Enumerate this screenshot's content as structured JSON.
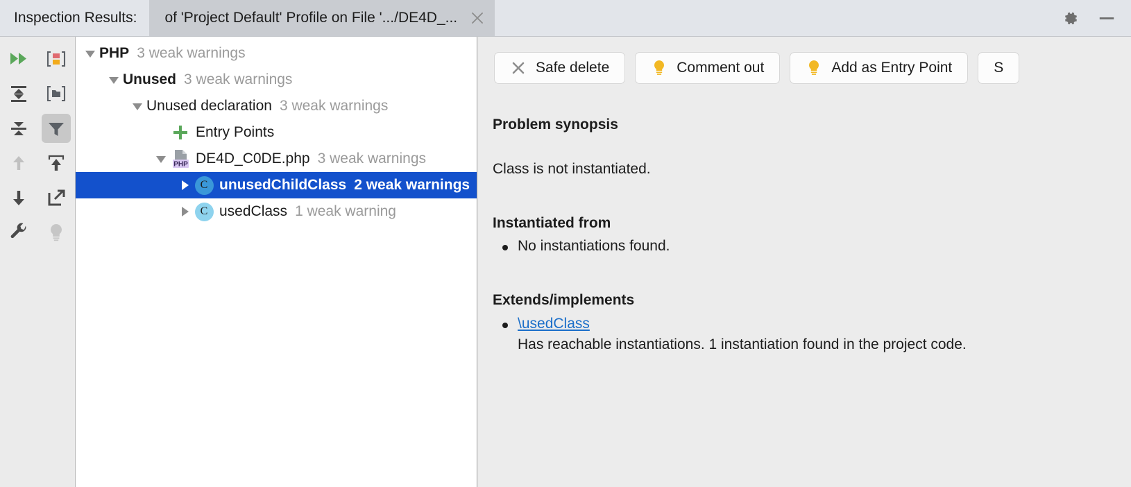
{
  "titlebar": {
    "label": "Inspection Results:",
    "tab_title": "of 'Project Default' Profile on File '.../DE4D_...",
    "close_icon": "close-icon",
    "settings_icon": "gear-icon",
    "minimize_icon": "minimize-icon"
  },
  "left_toolbar": {
    "items": [
      {
        "name": "rerun-icon",
        "title": "Rerun Inspection"
      },
      {
        "name": "group-by-severity-icon",
        "title": "Group by Severity"
      },
      {
        "name": "expand-all-icon",
        "title": "Expand All"
      },
      {
        "name": "collapse-to-folder-icon",
        "title": "Collapse"
      },
      {
        "name": "collapse-all-icon",
        "title": "Collapse All"
      },
      {
        "name": "filter-icon",
        "title": "Filter Resolved Items",
        "pressed": true
      },
      {
        "name": "previous-occurrence-icon",
        "title": "Previous Occurrence",
        "disabled": true
      },
      {
        "name": "export-icon",
        "title": "Export"
      },
      {
        "name": "next-occurrence-icon",
        "title": "Next Occurrence"
      },
      {
        "name": "open-in-new-window-icon",
        "title": "Open in New Window"
      },
      {
        "name": "settings-wrench-icon",
        "title": "Edit Settings"
      },
      {
        "name": "help-bulb-icon",
        "title": "Help"
      }
    ]
  },
  "tree": {
    "rows": [
      {
        "id": "php",
        "depth": 0,
        "twisty": "expanded",
        "icon": "none",
        "label": "PHP",
        "bold": true,
        "count": "3 weak warnings",
        "selected": false
      },
      {
        "id": "unused",
        "depth": 1,
        "twisty": "expanded",
        "icon": "none",
        "label": "Unused",
        "bold": true,
        "count": "3 weak warnings",
        "selected": false
      },
      {
        "id": "unused-declaration",
        "depth": 2,
        "twisty": "expanded",
        "icon": "none",
        "label": "Unused declaration",
        "bold": false,
        "count": "3 weak warnings",
        "selected": false
      },
      {
        "id": "entry-points",
        "depth": 3,
        "twisty": "none",
        "icon": "plus-icon",
        "label": "Entry Points",
        "bold": false,
        "count": "",
        "selected": false
      },
      {
        "id": "de4d-code-php",
        "depth": 3,
        "twisty": "expanded",
        "icon": "php-file-icon",
        "label": "DE4D_C0DE.php",
        "bold": false,
        "count": "3 weak warnings",
        "selected": false
      },
      {
        "id": "unused-child-class",
        "depth": 4,
        "twisty": "collapsed",
        "icon": "class-icon",
        "icon_color": "#3a97d9",
        "label": "unusedChildClass",
        "bold": false,
        "count": "2 weak warnings",
        "selected": true
      },
      {
        "id": "used-class",
        "depth": 4,
        "twisty": "collapsed",
        "icon": "class-icon",
        "icon_color": "#8ed3ee",
        "label": "usedClass",
        "bold": false,
        "count": "1 weak warning",
        "selected": false
      }
    ]
  },
  "detail": {
    "actions": [
      {
        "label": "Safe delete",
        "icon": "close-x-icon"
      },
      {
        "label": "Comment out",
        "icon": "lightbulb-icon"
      },
      {
        "label": "Add as Entry Point",
        "icon": "lightbulb-icon"
      },
      {
        "label": "S",
        "icon": "none"
      }
    ],
    "problem_synopsis_heading": "Problem synopsis",
    "problem_synopsis_text": "Class is not instantiated.",
    "instantiated_from_heading": "Instantiated from",
    "instantiated_from_items": [
      "No instantiations found."
    ],
    "extends_heading": "Extends/implements",
    "extends_link": "\\usedClass",
    "extends_description": "Has reachable instantiations. 1 instantiation found in the project code."
  },
  "colors": {
    "selection": "#1351cc",
    "titlebar": "#e2e5ea",
    "tab_active": "#c9ccd1",
    "toolbar": "#ebebeb",
    "detail_bg": "#ececec",
    "muted_text": "#9a9a9a",
    "link": "#1a6ec9",
    "green_accent": "#5aa75a",
    "yellow_accent": "#f2b824"
  }
}
